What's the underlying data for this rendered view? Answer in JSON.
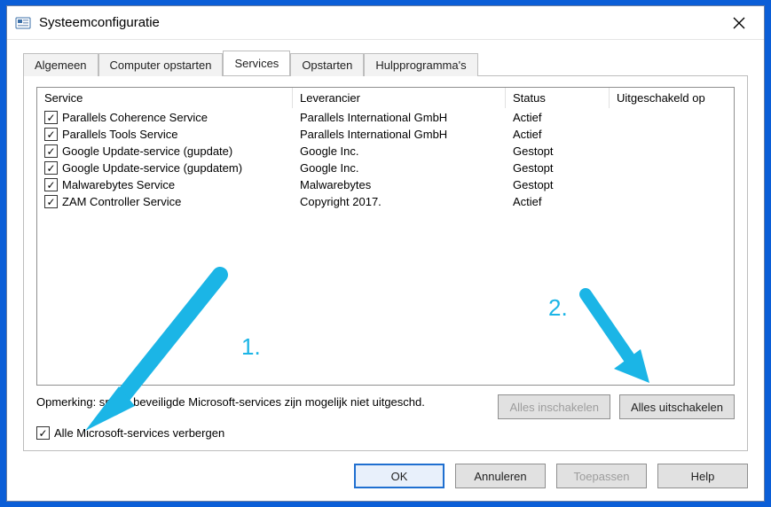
{
  "window": {
    "title": "Systeemconfiguratie"
  },
  "tabs": {
    "items": [
      {
        "label": "Algemeen"
      },
      {
        "label": "Computer opstarten"
      },
      {
        "label": "Services"
      },
      {
        "label": "Opstarten"
      },
      {
        "label": "Hulpprogramma's"
      }
    ],
    "activeIndex": 2
  },
  "columns": {
    "service": "Service",
    "leverancier": "Leverancier",
    "status": "Status",
    "uitgeschakeld": "Uitgeschakeld op"
  },
  "services": [
    {
      "checked": true,
      "name": "Parallels Coherence Service",
      "vendor": "Parallels International GmbH",
      "status": "Actief",
      "disabled_on": ""
    },
    {
      "checked": true,
      "name": "Parallels Tools Service",
      "vendor": "Parallels International GmbH",
      "status": "Actief",
      "disabled_on": ""
    },
    {
      "checked": true,
      "name": "Google Update-service (gupdate)",
      "vendor": "Google Inc.",
      "status": "Gestopt",
      "disabled_on": ""
    },
    {
      "checked": true,
      "name": "Google Update-service (gupdatem)",
      "vendor": "Google Inc.",
      "status": "Gestopt",
      "disabled_on": ""
    },
    {
      "checked": true,
      "name": "Malwarebytes Service",
      "vendor": "Malwarebytes",
      "status": "Gestopt",
      "disabled_on": ""
    },
    {
      "checked": true,
      "name": "ZAM Controller Service",
      "vendor": "Copyright 2017.",
      "status": "Actief",
      "disabled_on": ""
    }
  ],
  "note_pre": "Opmerking: s",
  "note_post": "mige beveiligde Microsoft-services zijn mogelijk niet uitgesch",
  "note_tail": "d.",
  "panel_buttons": {
    "enable_all": "Alles inschakelen",
    "disable_all": "Alles uitschakelen"
  },
  "hide_ms": {
    "checked": true,
    "label": "Alle Microsoft-services verbergen"
  },
  "dialog_buttons": {
    "ok": "OK",
    "cancel": "Annuleren",
    "apply": "Toepassen",
    "help": "Help"
  },
  "annotations": {
    "label1": "1.",
    "label2": "2."
  }
}
